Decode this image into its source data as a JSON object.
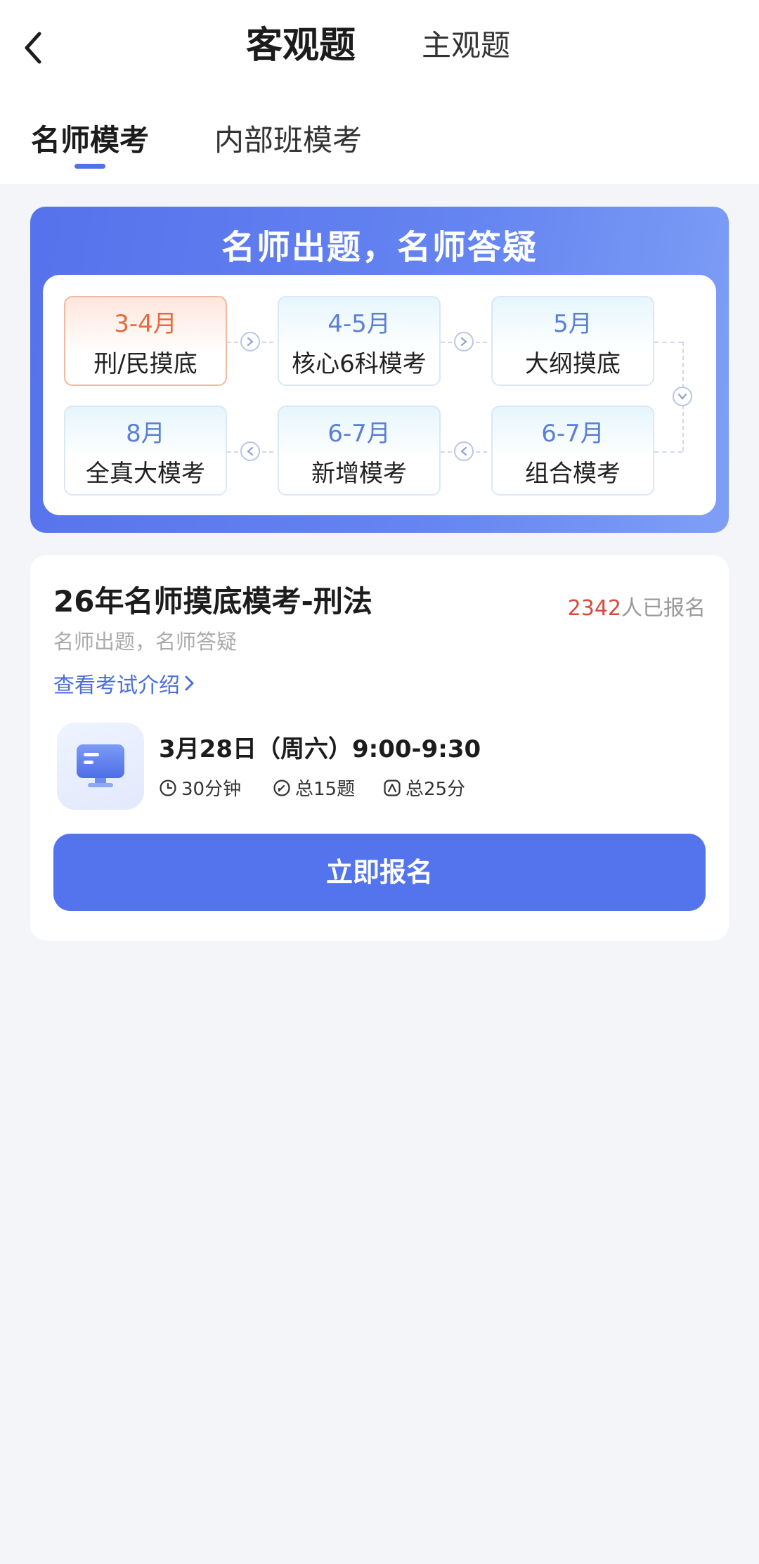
{
  "header": {
    "mode_tabs": [
      {
        "label": "客观题",
        "active": true
      },
      {
        "label": "主观题",
        "active": false
      }
    ],
    "sub_tabs": [
      {
        "label": "名师模考",
        "active": true
      },
      {
        "label": "内部班模考",
        "active": false
      }
    ]
  },
  "banner": {
    "title": "名师出题，名师答疑",
    "steps": [
      {
        "month": "3-4月",
        "name": "刑/民摸底",
        "current": true
      },
      {
        "month": "4-5月",
        "name": "核心6科模考",
        "current": false
      },
      {
        "month": "5月",
        "name": "大纲摸底",
        "current": false
      },
      {
        "month": "6-7月",
        "name": "组合模考",
        "current": false
      },
      {
        "month": "6-7月",
        "name": "新增模考",
        "current": false
      },
      {
        "month": "8月",
        "name": "全真大模考",
        "current": false
      }
    ]
  },
  "exam": {
    "title": "26年名师摸底模考-刑法",
    "signup_count": "2342",
    "signup_suffix": "人已报名",
    "subtitle": "名师出题，名师答疑",
    "intro_link": "查看考试介绍",
    "time": "3月28日（周六）9:00-9:30",
    "duration": "30分钟",
    "questions": "总15题",
    "score": "总25分",
    "button_label": "立即报名"
  },
  "colors": {
    "accent": "#5374ec",
    "current_step": "#e56a3c",
    "count": "#d9493c"
  }
}
